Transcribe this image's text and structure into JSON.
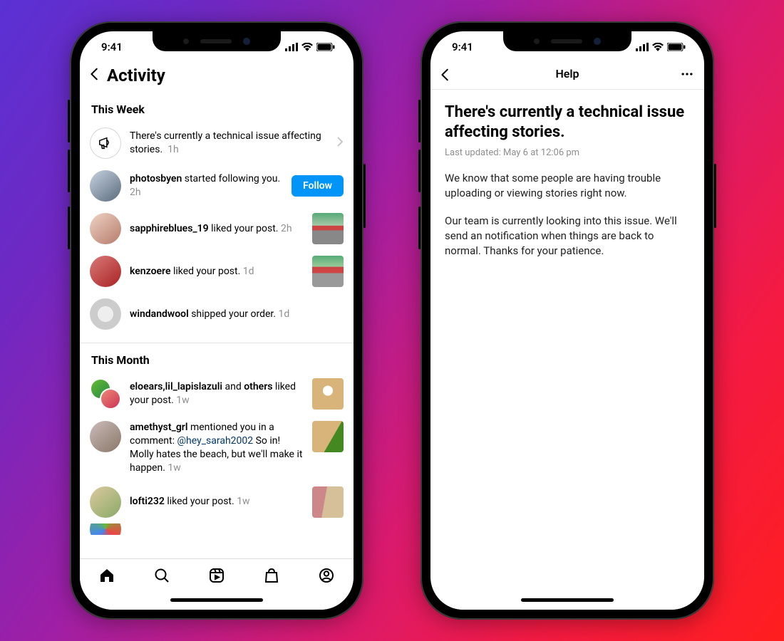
{
  "status": {
    "time": "9:41"
  },
  "activity": {
    "title": "Activity",
    "sections": {
      "week": {
        "title": "This Week",
        "items": [
          {
            "text": "There's currently a technical issue affecting stories.",
            "time": "1h",
            "type": "announce"
          },
          {
            "user": "photosbyen",
            "action": " started following you.",
            "time": "2h",
            "type": "follow",
            "button": "Follow"
          },
          {
            "user": "sapphireblues_19",
            "action": " liked your post.",
            "time": "2h",
            "type": "like"
          },
          {
            "user": "kenzoere",
            "action": " liked your post.",
            "time": "1d",
            "type": "like"
          },
          {
            "user": "windandwool",
            "action": " shipped your order.",
            "time": "1d",
            "type": "order"
          }
        ]
      },
      "month": {
        "title": "This Month",
        "items": [
          {
            "user": "eloears,lil_lapislazuli",
            "action_prefix": " and ",
            "others": "others",
            "action": " liked your post.",
            "time": "1w"
          },
          {
            "user": "amethyst_grl",
            "action": " mentioned you in a comment: ",
            "mention": "@hey_sarah2002",
            "tail": " So in! Molly hates the beach, but we'll make it happen.",
            "time": "1w"
          },
          {
            "user": "lofti232",
            "action": " liked your post.",
            "time": "1w"
          }
        ]
      }
    }
  },
  "help": {
    "title": "Help",
    "heading": "There's currently a technical issue affecting stories.",
    "updated": "Last updated: May 6 at 12:06 pm",
    "p1": "We know that some people are having trouble uploading or viewing stories right now.",
    "p2": "Our team is currently looking into this issue. We'll send an notification when things are back to normal. Thanks for your patience."
  }
}
